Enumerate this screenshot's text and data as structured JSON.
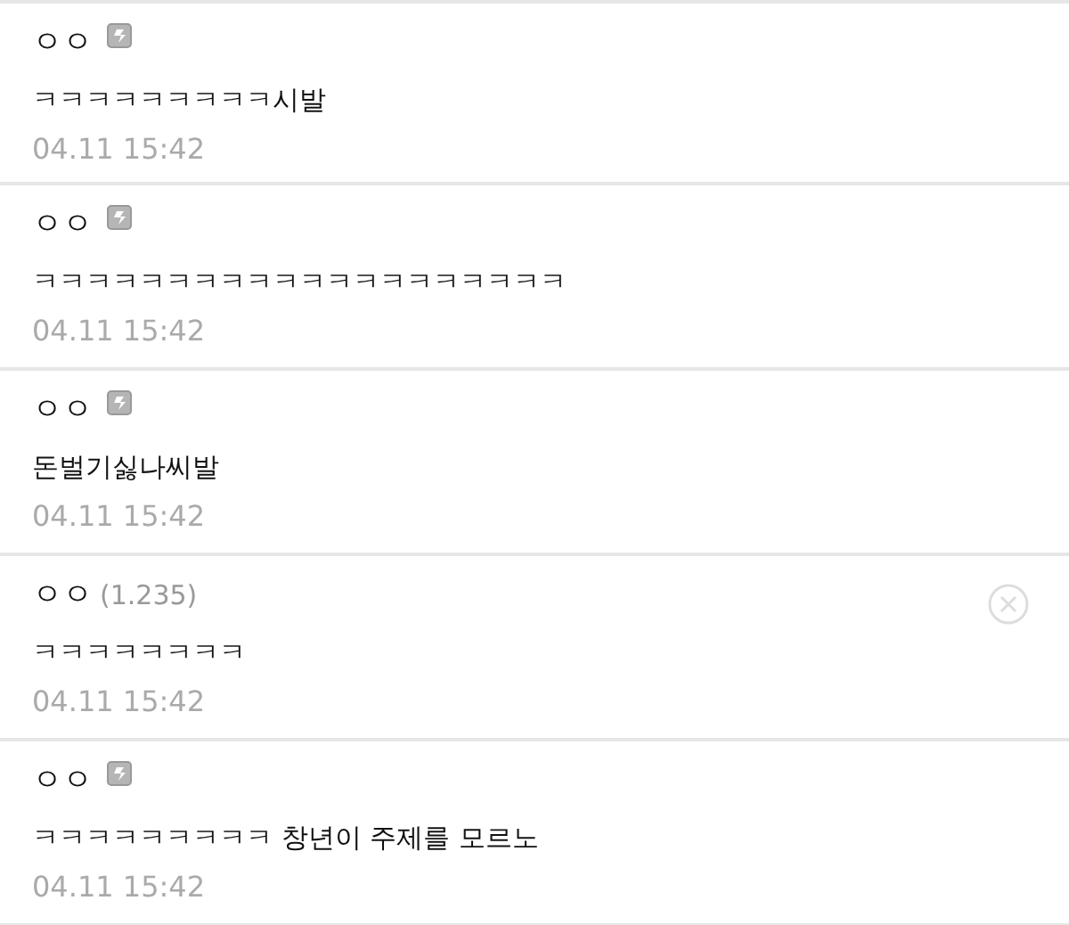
{
  "comments": [
    {
      "kind": "member",
      "author": "ㅇㅇ",
      "text": "ㅋㅋㅋㅋㅋㅋㅋㅋㅋ시발",
      "time": "04.11 15:42",
      "deletable": false
    },
    {
      "kind": "member",
      "author": "ㅇㅇ",
      "text": "ㅋㅋㅋㅋㅋㅋㅋㅋㅋㅋㅋㅋㅋㅋㅋㅋㅋㅋㅋㅋ",
      "time": "04.11 15:42",
      "deletable": false
    },
    {
      "kind": "member",
      "author": "ㅇㅇ",
      "text": "돈벌기싫나씨발",
      "time": "04.11 15:42",
      "deletable": false
    },
    {
      "kind": "guest",
      "author": "ㅇㅇ",
      "ip": "(1.235)",
      "text": "ㅋㅋㅋㅋㅋㅋㅋㅋ",
      "time": "04.11 15:42",
      "deletable": true
    },
    {
      "kind": "member",
      "author": "ㅇㅇ",
      "text": "ㅋㅋㅋㅋㅋㅋㅋㅋㅋ 창년이 주제를 모르노",
      "time": "04.11 15:42",
      "deletable": false
    }
  ]
}
